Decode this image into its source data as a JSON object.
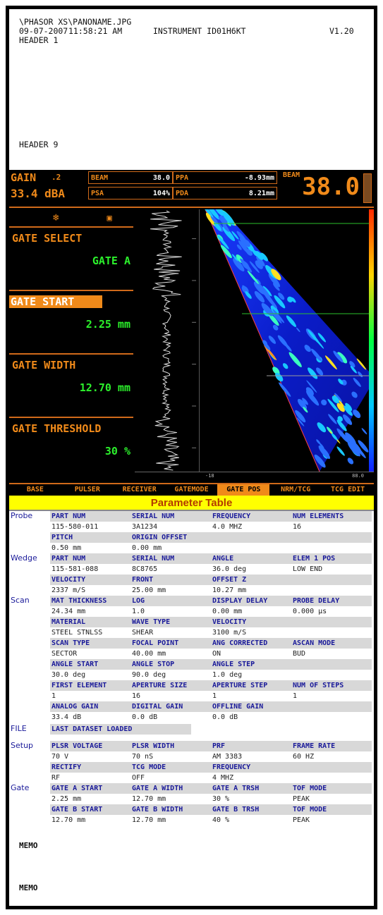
{
  "header": {
    "path": "\\PHASOR XS\\PANONAME.JPG",
    "date": "09-07-2007",
    "time": "11:58:21 AM",
    "instrument": "INSTRUMENT ID01H6KT",
    "version": "V1.20",
    "header1": "HEADER 1",
    "header9": "HEADER 9"
  },
  "readouts": {
    "gain_label": "GAIN",
    "gain_step": ".2",
    "gain_value": "33.4 dBA",
    "beam_label": "BEAM",
    "beam_value": "38.0",
    "psa_label": "PSA",
    "psa_value": "104%",
    "ppa_label": "PPA",
    "ppa_value": "-8.93mm",
    "pda_label": "PDA",
    "pda_value": "8.21mm",
    "big_label": "BEAM",
    "big_value": "38.0"
  },
  "gates": [
    {
      "label": "GATE SELECT",
      "value": "GATE A"
    },
    {
      "label": "GATE START",
      "value": "2.25 mm"
    },
    {
      "label": "GATE WIDTH",
      "value": "12.70 mm"
    },
    {
      "label": "GATE THRESHOLD",
      "value": "30 %"
    }
  ],
  "menu": [
    "BASE",
    "PULSER",
    "RECEIVER",
    "GATEMODE",
    "GATE POS",
    "NRM/TCG",
    "TCG EDIT"
  ],
  "scale": {
    "left": "-18",
    "right": "88.0"
  },
  "param_title": "Parameter Table",
  "groups": [
    {
      "name": "Probe",
      "rows": [
        [
          [
            "PART NUM",
            "115-580-011"
          ],
          [
            "SERIAL NUM",
            "3A1234"
          ],
          [
            "FREQUENCY",
            "4.0 MHZ"
          ],
          [
            "NUM ELEMENTS",
            "16"
          ]
        ],
        [
          [
            "PITCH",
            "0.50 mm"
          ],
          [
            "ORIGIN OFFSET",
            "0.00 mm"
          ],
          [
            "",
            ""
          ],
          [
            "",
            ""
          ]
        ]
      ]
    },
    {
      "name": "Wedge",
      "rows": [
        [
          [
            "PART NUM",
            "115-581-088"
          ],
          [
            "SERIAL NUM",
            "8C8765"
          ],
          [
            "ANGLE",
            "36.0 deg"
          ],
          [
            "ELEM 1 POS",
            "LOW END"
          ]
        ],
        [
          [
            "VELOCITY",
            "2337 m/S"
          ],
          [
            "FRONT",
            "25.00 mm"
          ],
          [
            "OFFSET Z",
            "10.27 mm"
          ],
          [
            "",
            ""
          ]
        ]
      ]
    },
    {
      "name": "Scan",
      "rows": [
        [
          [
            "MAT THICKNESS",
            "24.34 mm"
          ],
          [
            "LOG",
            "1.0"
          ],
          [
            "DISPLAY DELAY",
            "0.00 mm"
          ],
          [
            "PROBE DELAY",
            "0.000 µs"
          ]
        ],
        [
          [
            "MATERIAL",
            "STEEL STNLSS"
          ],
          [
            "WAVE TYPE",
            "SHEAR"
          ],
          [
            "VELOCITY",
            "3100 m/S"
          ],
          [
            "",
            ""
          ]
        ],
        [
          [
            "SCAN TYPE",
            "SECTOR"
          ],
          [
            "FOCAL POINT",
            "40.00 mm"
          ],
          [
            "ANG CORRECTED",
            "ON"
          ],
          [
            "ASCAN MODE",
            "BUD"
          ]
        ],
        [
          [
            "ANGLE START",
            "30.0 deg"
          ],
          [
            "ANGLE STOP",
            "90.0 deg"
          ],
          [
            "ANGLE STEP",
            "1.0 deg"
          ],
          [
            "",
            ""
          ]
        ],
        [
          [
            "FIRST ELEMENT",
            "1"
          ],
          [
            "APERTURE SIZE",
            "16"
          ],
          [
            "APERTURE STEP",
            "1"
          ],
          [
            "NUM OF STEPS",
            "1"
          ]
        ],
        [
          [
            "ANALOG GAIN",
            "33.4 dB"
          ],
          [
            "DIGITAL GAIN",
            "0.0 dB"
          ],
          [
            "OFFLINE GAIN",
            "0.0 dB"
          ],
          [
            "",
            ""
          ]
        ]
      ]
    },
    {
      "name": "Setup",
      "rows": [
        [
          [
            "PLSR VOLTAGE",
            "70 V"
          ],
          [
            "PLSR WIDTH",
            "70 nS"
          ],
          [
            "PRF",
            "AM 3383"
          ],
          [
            "FRAME RATE",
            "60 HZ"
          ]
        ],
        [
          [
            "RECTIFY",
            "RF"
          ],
          [
            "TCG MODE",
            "OFF"
          ],
          [
            "FREQUENCY",
            "4 MHZ"
          ],
          [
            "",
            ""
          ]
        ]
      ]
    },
    {
      "name": "Gate",
      "rows": [
        [
          [
            "GATE A START",
            "2.25 mm"
          ],
          [
            "GATE A WIDTH",
            "12.70 mm"
          ],
          [
            "GATE A TRSH",
            "30 %"
          ],
          [
            "TOF MODE",
            "PEAK"
          ]
        ],
        [
          [
            "GATE B START",
            "12.70 mm"
          ],
          [
            "GATE B WIDTH",
            "12.70 mm"
          ],
          [
            "GATE B TRSH",
            "40 %"
          ],
          [
            "TOF MODE",
            "PEAK"
          ]
        ]
      ]
    }
  ],
  "file": {
    "name": "FILE",
    "label": "LAST DATASET LOADED"
  },
  "memo1": "MEMO",
  "memo2": "MEMO",
  "colors": {
    "accent": "#f08a1a",
    "value_green": "#2cf02c",
    "table_key": "#1a1a9a",
    "title_bg": "#ffff00"
  }
}
